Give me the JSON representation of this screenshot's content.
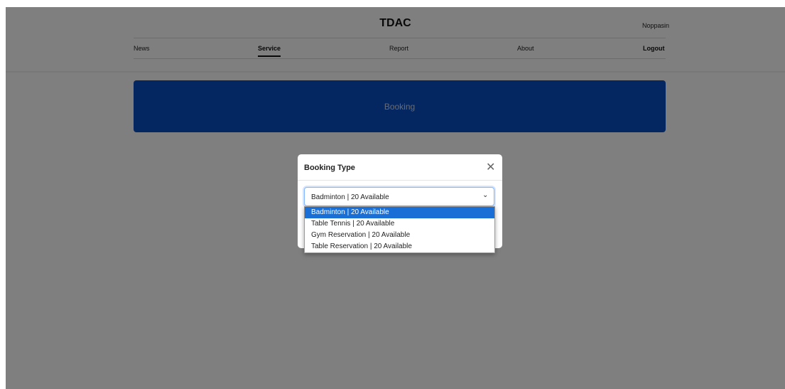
{
  "header": {
    "title": "TDAC",
    "user": "Noppasin",
    "nav": [
      {
        "label": "News"
      },
      {
        "label": "Service"
      },
      {
        "label": "Report"
      },
      {
        "label": "About"
      },
      {
        "label": "Logout"
      }
    ]
  },
  "banner": {
    "label": "Booking"
  },
  "modal": {
    "title": "Booking Type",
    "close_icon": "close-icon",
    "select": {
      "value": "Badminton | 20 Available",
      "options": [
        "Badminton | 20 Available",
        "Table Tennis | 20 Available",
        "Gym Reservation | 20 Available",
        "Table Reservation | 20 Available"
      ],
      "highlighted_index": 0
    }
  },
  "colors": {
    "banner": "#0a4fc2",
    "selected_option": "#1a6fd6",
    "focus_border": "#86b7fe"
  }
}
